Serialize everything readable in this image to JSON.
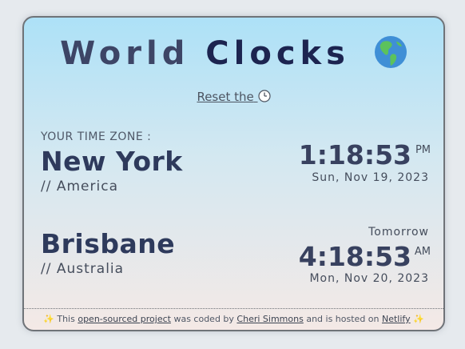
{
  "header": {
    "title_word1": "World",
    "title_word2": "Clocks",
    "globe_icon": "globe-americas-icon"
  },
  "reset": {
    "label": "Reset the",
    "icon": "clock-icon"
  },
  "local": {
    "zone_label": "YOUR TIME ZONE :",
    "city": "New York",
    "region": "// America",
    "time": "1:18:53",
    "ampm": "PM",
    "date": "Sun, Nov 19, 2023"
  },
  "remote": {
    "city": "Brisbane",
    "region": "// Australia",
    "day_note": "Tomorrow",
    "time": "4:18:53",
    "ampm": "AM",
    "date": "Mon, Nov 20, 2023"
  },
  "footer": {
    "sparkle": "✨",
    "text1": "This",
    "link1": "open-sourced project",
    "text2": "was coded by",
    "link2": "Cheri Simmons",
    "text3": "and is hosted on",
    "link3": "Netlify"
  },
  "colors": {
    "card_top": "#ade1f7",
    "card_bottom": "#f4e9e6",
    "title": "#3d4566",
    "text": "#2e3a5c"
  }
}
